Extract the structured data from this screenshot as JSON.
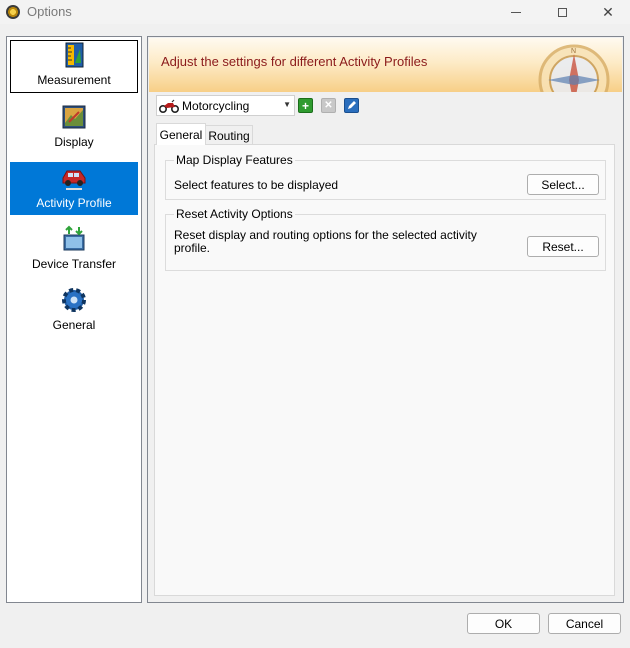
{
  "window": {
    "title": "Options",
    "icon": "app-globe-icon"
  },
  "sidebar": {
    "items": [
      {
        "label": "Measurement",
        "icon": "ruler-icon",
        "selected": false
      },
      {
        "label": "Display",
        "icon": "display-icon",
        "selected": false
      },
      {
        "label": "Activity Profile",
        "icon": "car-icon",
        "selected": true
      },
      {
        "label": "Device Transfer",
        "icon": "device-transfer-icon",
        "selected": false
      },
      {
        "label": "General",
        "icon": "gear-icon",
        "selected": false
      }
    ]
  },
  "banner": {
    "text": "Adjust the settings for different Activity Profiles",
    "icon": "compass-icon"
  },
  "profile": {
    "selected": "Motorcycling",
    "icon": "motorcycle-icon",
    "tools": [
      "add-profile",
      "delete-profile",
      "edit-profile"
    ]
  },
  "tabs": [
    {
      "label": "General",
      "active": true
    },
    {
      "label": "Routing",
      "active": false
    }
  ],
  "groups": {
    "map_display": {
      "title": "Map Display Features",
      "description": "Select features to be displayed",
      "button": "Select..."
    },
    "reset": {
      "title": "Reset Activity Options",
      "description_line1": "Reset display and routing options for the selected activity",
      "description_line2": "profile.",
      "button": "Reset..."
    }
  },
  "footer": {
    "ok_label": "OK",
    "cancel_label": "Cancel"
  },
  "colors": {
    "selection": "#0078d7",
    "banner_text": "#8b1a1a",
    "add_green": "#2f9b2f",
    "edit_blue": "#2a6ebd"
  }
}
